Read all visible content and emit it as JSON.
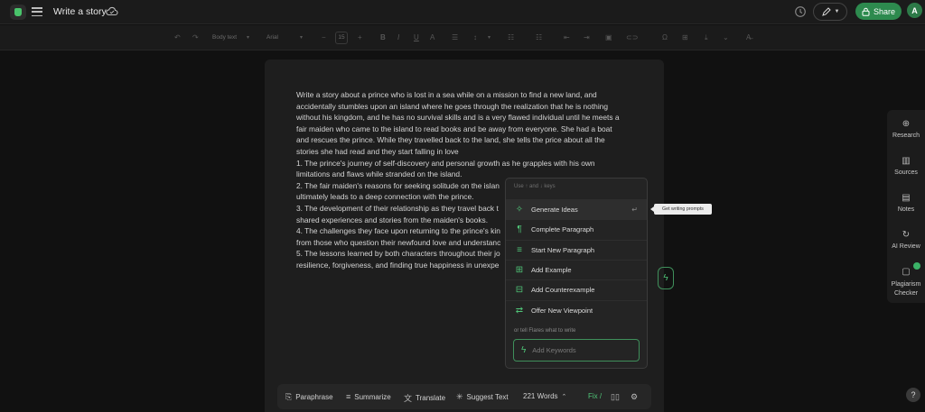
{
  "header": {
    "title": "Write a story",
    "share_label": "Share",
    "avatar_initial": "A"
  },
  "toolbar": {
    "style_select": "Body text",
    "font_select": "Arial",
    "font_size": "15"
  },
  "document": {
    "paragraph_lines": [
      "Write a story about a prince who is lost in a sea while on a mission to find a new land, and",
      "accidentally stumbles upon an island where he goes through the realization that he is nothing",
      "without his kingdom, and he has no survival skills and is a very flawed individual until he meets a",
      "fair maiden who came to the island to read books and be away from everyone. She had a boat",
      "and rescues the prince. While they travelled back to the land, she tells the price about all the",
      "stories she had read and they start falling in love"
    ],
    "list_lines": [
      "1. The prince's journey of self-discovery and personal growth as he grapples with his own",
      "limitations and flaws while stranded on the island.",
      "2. The fair maiden's reasons for seeking solitude on the islan",
      "ultimately leads to a deep connection with the prince.",
      "3. The development of their relationship as they travel back t",
      "shared experiences and stories from the maiden's books.",
      "4. The challenges they face upon returning to the prince's kin",
      "from those who question their newfound love and understanc",
      "5. The lessons learned by both characters throughout their jo",
      "resilience, forgiveness, and finding true happiness in unexpe"
    ]
  },
  "flares_menu": {
    "hint": "Use ↑ and ↓ keys",
    "items": [
      {
        "label": "Generate Ideas",
        "icon": "lightbulb-icon"
      },
      {
        "label": "Complete Paragraph",
        "icon": "paragraph-icon"
      },
      {
        "label": "Start New Paragraph",
        "icon": "lines-icon"
      },
      {
        "label": "Add Example",
        "icon": "grid-icon"
      },
      {
        "label": "Add Counterexample",
        "icon": "grid-minus-icon"
      },
      {
        "label": "Offer New Viewpoint",
        "icon": "swap-icon"
      }
    ],
    "tell_label": "or tell Flares what to write",
    "keywords_placeholder": "Add Keywords",
    "tooltip": "Get writing prompts"
  },
  "bottom_bar": {
    "paraphrase": "Paraphrase",
    "summarize": "Summarize",
    "translate": "Translate",
    "suggest_text": "Suggest Text",
    "word_count": "221 Words",
    "fix": "Fix /"
  },
  "side_panel": {
    "items": [
      {
        "label": "Research",
        "icon": "globe-icon"
      },
      {
        "label": "Sources",
        "icon": "books-icon"
      },
      {
        "label": "Notes",
        "icon": "notes-icon"
      },
      {
        "label": "AI Review",
        "icon": "review-icon"
      },
      {
        "label_line1": "Plagiarism",
        "label_line2": "Checker",
        "icon": "plagiarism-icon"
      }
    ]
  },
  "help_label": "?"
}
